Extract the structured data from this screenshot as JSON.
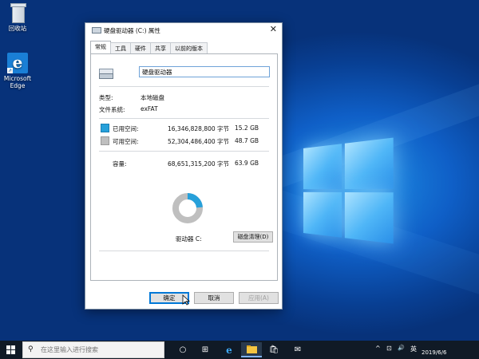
{
  "desktop": {
    "icons": [
      {
        "label": "回收站"
      },
      {
        "label": "Microsoft Edge"
      }
    ]
  },
  "dialog": {
    "title": "硬盘驱动器 (C:) 属性",
    "close_glyph": "✕",
    "tabs": [
      "常规",
      "工具",
      "硬件",
      "共享",
      "以前的版本"
    ],
    "active_tab": "常规",
    "drive_name": "硬盘驱动器",
    "type_label": "类型:",
    "type_value": "本地磁盘",
    "fs_label": "文件系统:",
    "fs_value": "exFAT",
    "used_label": "已用空间:",
    "used_bytes": "16,346,828,800 字节",
    "used_size": "15.2 GB",
    "free_label": "可用空间:",
    "free_bytes": "52,304,486,400 字节",
    "free_size": "48.7 GB",
    "capacity_label": "容量:",
    "capacity_bytes": "68,651,315,200 字节",
    "capacity_size": "63.9 GB",
    "drive_caption": "驱动器 C:",
    "cleanup_label": "磁盘清理(D)",
    "ok_label": "确定",
    "cancel_label": "取消",
    "apply_label": "应用(A)",
    "used_fraction": 0.238,
    "colors": {
      "used": "#26a0da",
      "free": "#bfbfbf",
      "accent": "#0078d7"
    }
  },
  "taskbar": {
    "search_placeholder": "在这里输入进行搜索",
    "search_glyph": "⚲",
    "task_view_glyph": "○",
    "multitask_glyph": "⊞",
    "edge_glyph": "e",
    "store_glyph": "🛍",
    "mail_glyph": "✉",
    "tray_up_glyph": "^",
    "tray_network_glyph": "⊡",
    "tray_volume_glyph": "🔊",
    "ime": "英",
    "date": "2019/6/6"
  }
}
